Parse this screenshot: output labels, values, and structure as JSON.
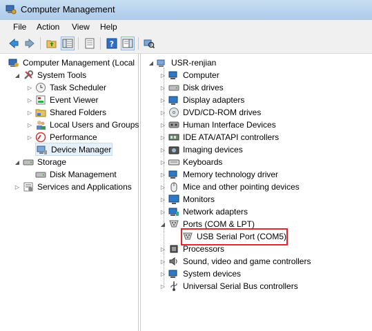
{
  "window": {
    "title": "Computer Management"
  },
  "menu": [
    "File",
    "Action",
    "View",
    "Help"
  ],
  "colors": {
    "highlight_border": "#e0262b",
    "title_bar": "#b7d2ee"
  },
  "left_tree": {
    "root": "Computer Management (Local",
    "system_tools": "System Tools",
    "items": [
      "Task Scheduler",
      "Event Viewer",
      "Shared Folders",
      "Local Users and Groups",
      "Performance",
      "Device Manager"
    ],
    "storage": "Storage",
    "disk_management": "Disk Management",
    "services": "Services and Applications"
  },
  "right_tree": {
    "root": "USR-renjian",
    "categories": [
      "Computer",
      "Disk drives",
      "Display adapters",
      "DVD/CD-ROM drives",
      "Human Interface Devices",
      "IDE ATA/ATAPI controllers",
      "Imaging devices",
      "Keyboards",
      "Memory technology driver",
      "Mice and other pointing devices",
      "Monitors",
      "Network adapters",
      "Ports (COM & LPT)"
    ],
    "port_child": "USB Serial Port (COM5)",
    "after": [
      "Processors",
      "Sound, video and game controllers",
      "System devices",
      "Universal Serial Bus controllers"
    ]
  }
}
